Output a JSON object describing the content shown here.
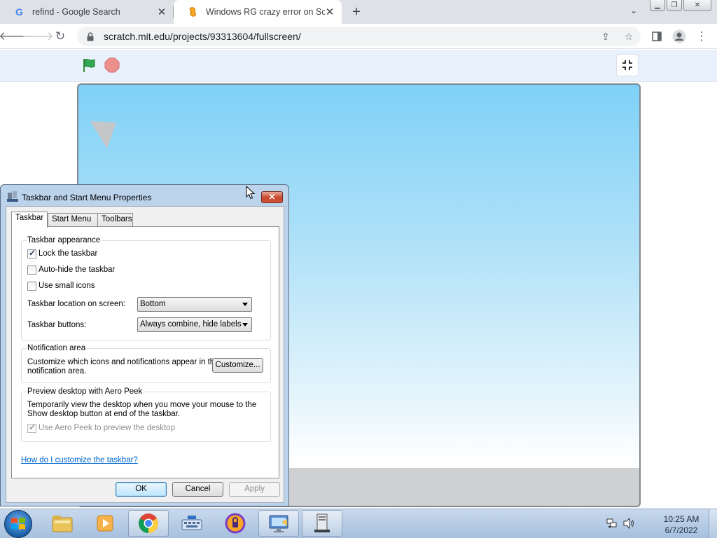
{
  "browser": {
    "tabs": [
      {
        "title": "refind - Google Search",
        "favicon": "google-g-icon"
      },
      {
        "title": "Windows RG crazy error on Scratch",
        "favicon": "scratch-icon"
      }
    ],
    "url": "scratch.mit.edu/projects/93313604/fullscreen/",
    "window_buttons": [
      "minimize",
      "restore",
      "close"
    ]
  },
  "dialog": {
    "title": "Taskbar and Start Menu Properties",
    "tabs": [
      "Taskbar",
      "Start Menu",
      "Toolbars"
    ],
    "appearance": {
      "title": "Taskbar appearance",
      "lock_label": "Lock the taskbar",
      "lock_checked": true,
      "autohide_label": "Auto-hide the taskbar",
      "autohide_checked": false,
      "small_icons_label": "Use small icons",
      "small_icons_checked": false,
      "location_label": "Taskbar location on screen:",
      "location_value": "Bottom",
      "buttons_label": "Taskbar buttons:",
      "buttons_value": "Always combine, hide labels"
    },
    "notification": {
      "title": "Notification area",
      "text_line1": "Customize which icons and notifications appear in the",
      "text_line2": "notification area.",
      "customize_label": "Customize..."
    },
    "aero": {
      "title": "Preview desktop with Aero Peek",
      "text_line1": "Temporarily view the desktop when you move your mouse to the",
      "text_line2": "Show desktop button at end of the taskbar.",
      "checkbox_label": "Use Aero Peek to preview the desktop",
      "checked": true
    },
    "help_link": "How do I customize the taskbar?",
    "ok_label": "OK",
    "cancel_label": "Cancel",
    "apply_label": "Apply"
  },
  "taskbar": {
    "items": [
      "explorer",
      "media-player",
      "chrome",
      "keyboard",
      "browser",
      "remote-desktop",
      "server"
    ],
    "time": "10:25 AM",
    "date": "6/7/2022"
  },
  "colors": {
    "stage_sky": "#7fd1f7",
    "green_flag": "#2fa84f",
    "stop": "#ec5959",
    "link": "#0066cc"
  }
}
